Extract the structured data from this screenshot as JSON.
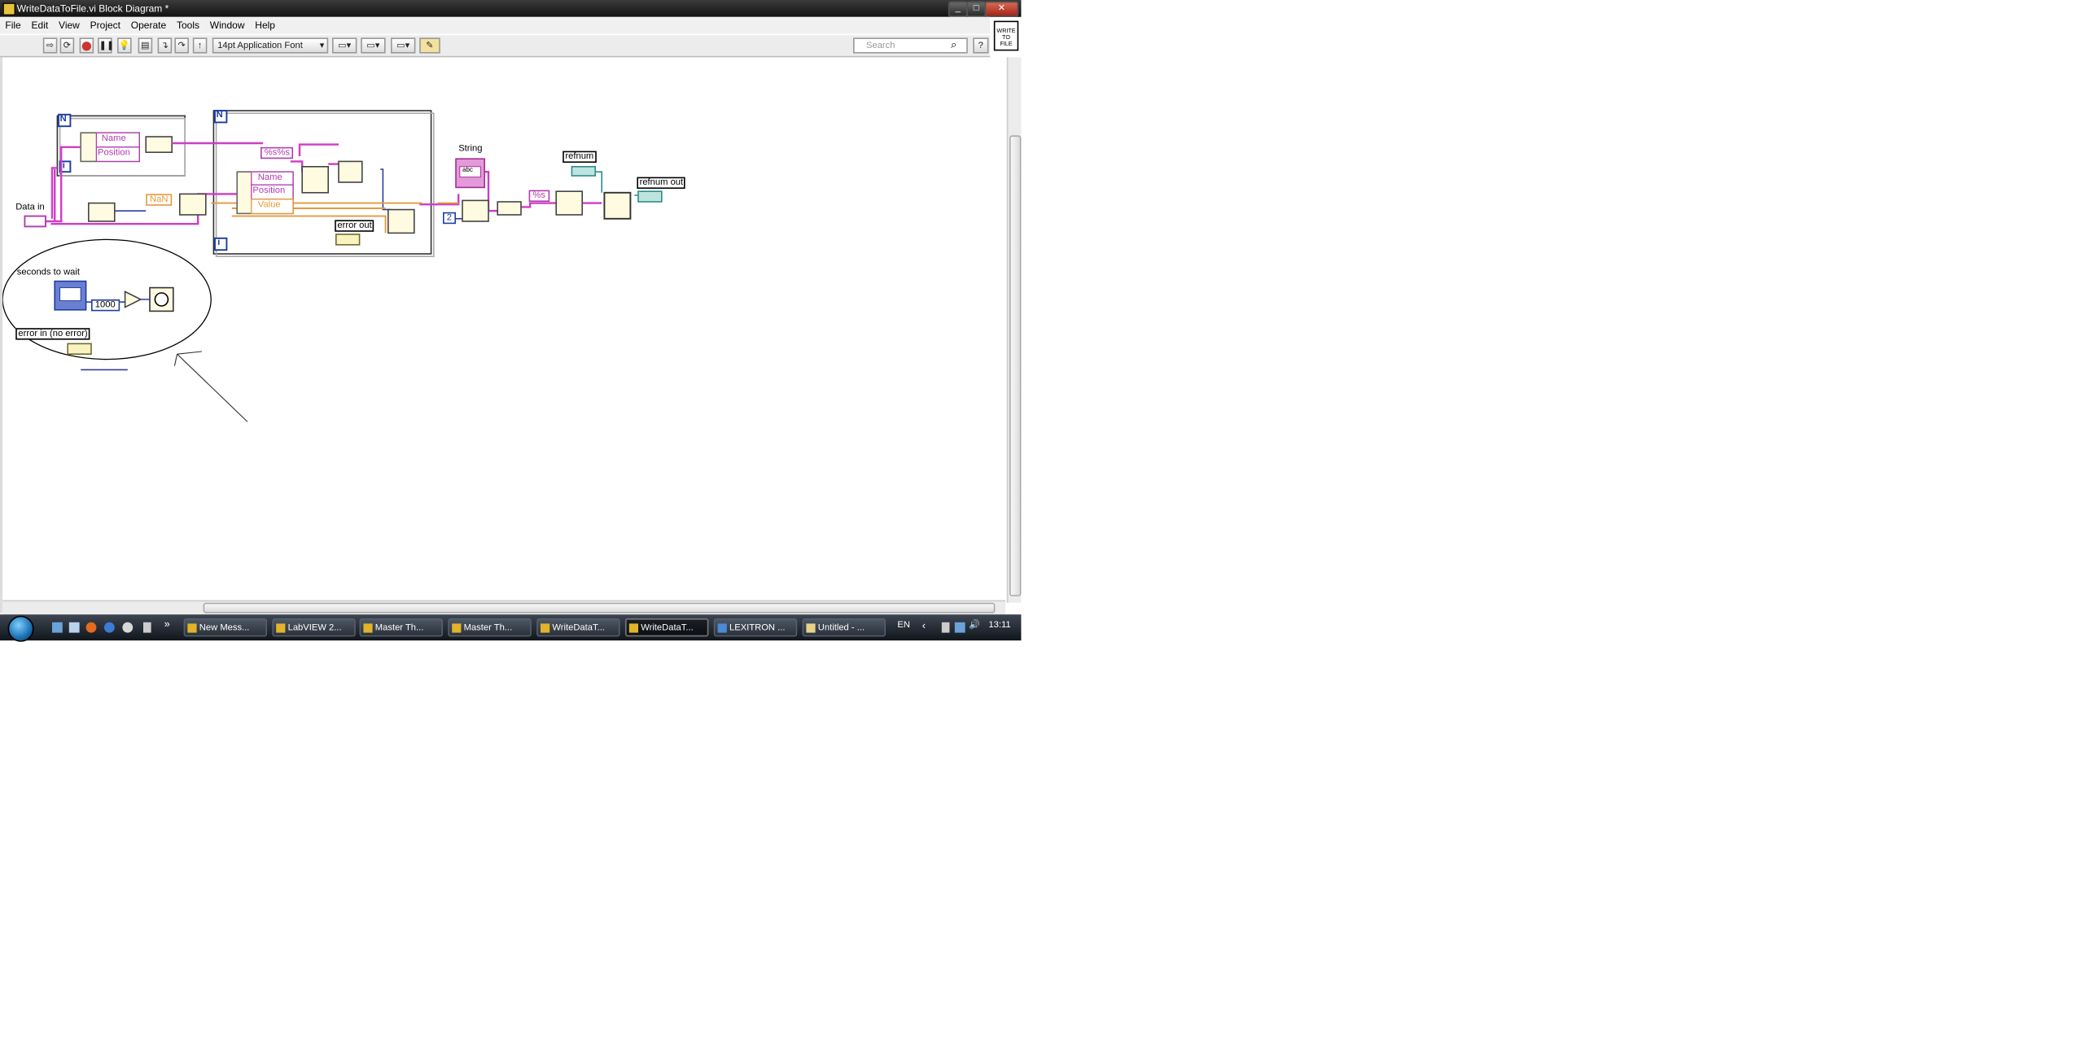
{
  "window": {
    "title": "WriteDataToFile.vi Block Diagram *",
    "controls": [
      "_",
      "□",
      "✕"
    ]
  },
  "menu": [
    "File",
    "Edit",
    "View",
    "Project",
    "Operate",
    "Tools",
    "Window",
    "Help"
  ],
  "toolbar": {
    "font_select": "14pt Application Font",
    "search_placeholder": "Search"
  },
  "vi_icon": {
    "lines": [
      "WRITE",
      "TO",
      "FILE"
    ]
  },
  "diagram": {
    "labels": {
      "data_in": "Data in",
      "string": "String",
      "refnum": "refnum",
      "refnum_out": "refnum out",
      "error_out": "error out",
      "seconds_to_wait": "seconds to wait",
      "error_in": "error in (no error)"
    },
    "constants": {
      "nan": "NaN",
      "format1": "%s%s",
      "format2": "%s",
      "const_1000": "1000",
      "const_2": "2",
      "abc": "abc"
    },
    "bundle_fields_top": [
      "Name",
      "Position"
    ],
    "bundle_fields_inner": [
      "Name",
      "Position",
      "Value"
    ],
    "loop_terminal_n": "N",
    "loop_terminal_i": "i"
  },
  "taskbar": {
    "items": [
      {
        "label": "New Mess...",
        "active": false
      },
      {
        "label": "LabVIEW 2...",
        "active": false
      },
      {
        "label": "Master Th...",
        "active": false
      },
      {
        "label": "Master Th...",
        "active": false
      },
      {
        "label": "WriteDataT...",
        "active": false
      },
      {
        "label": "WriteDataT...",
        "active": true
      },
      {
        "label": "LEXITRON ...",
        "active": false
      },
      {
        "label": "Untitled - ...",
        "active": false
      }
    ],
    "lang": "EN",
    "clock": "13:11"
  }
}
